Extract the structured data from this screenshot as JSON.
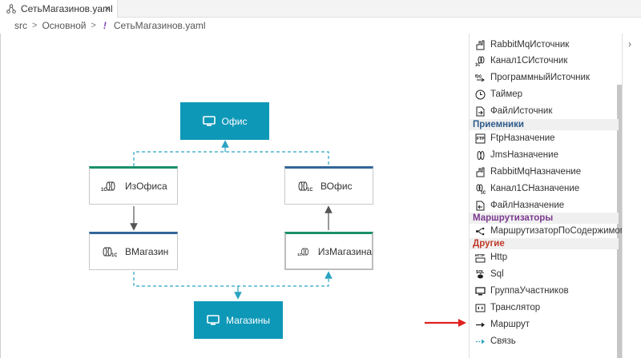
{
  "tab": {
    "title": "СетьМагазинов.yaml",
    "close": "×"
  },
  "breadcrumb": {
    "src": "src",
    "sep": ">",
    "main": "Основной",
    "excl": "!",
    "file": "СетьМагазинов.yaml"
  },
  "nodes": {
    "office": "Офис",
    "stores": "Магазины",
    "from_office": "ИзОфиса",
    "to_office": "ВОфис",
    "to_store": "ВМагазин",
    "from_store": "ИзМагазина"
  },
  "palette": {
    "items_top": [
      "RabbitMqИсточник",
      "Канал1СИсточник",
      "ПрограммныйИсточник",
      "Таймер",
      "ФайлИсточник"
    ],
    "section_receivers": "Приемники",
    "items_receivers": [
      "FtpНазначение",
      "JmsНазначение",
      "RabbitMqНазначение",
      "Канал1СНазначение",
      "ФайлНазначение"
    ],
    "section_routers": "Маршрутизаторы",
    "items_routers": [
      "МаршрутизаторПоСодержимому"
    ],
    "section_other": "Другие",
    "items_other": [
      "Http",
      "Sql",
      "ГруппаУчастников",
      "Транслятор",
      "Маршрут",
      "Связь"
    ]
  },
  "colors": {
    "accent": "#0e98b8",
    "green": "#1a8f6a",
    "blue": "#336699",
    "arrow": "#e02020"
  }
}
